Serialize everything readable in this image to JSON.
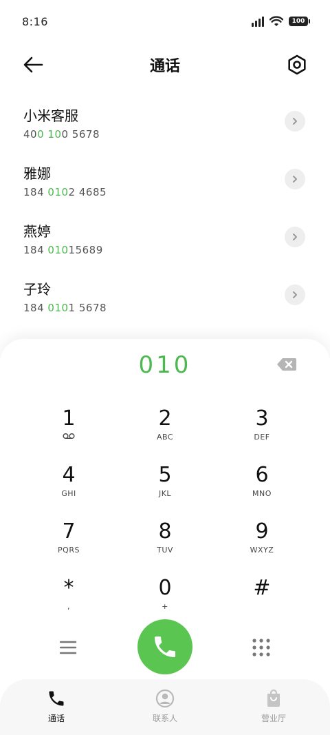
{
  "status": {
    "time": "8:16",
    "battery": "100"
  },
  "header": {
    "title": "通话"
  },
  "contacts": [
    {
      "name": "小米客服",
      "num_pre": "40",
      "num_hl": "0 10",
      "num_post": "0 5678"
    },
    {
      "name": "雅娜",
      "num_pre": "184 ",
      "num_hl": "010",
      "num_post": "2 4685"
    },
    {
      "name": "燕婷",
      "num_pre": "184 ",
      "num_hl": "010",
      "num_post": "15689"
    },
    {
      "name": "子玲",
      "num_pre": "184 ",
      "num_hl": "010",
      "num_post": "1 5678"
    }
  ],
  "dialer": {
    "input": "010",
    "keys": [
      {
        "digit": "1",
        "letters": ""
      },
      {
        "digit": "2",
        "letters": "ABC"
      },
      {
        "digit": "3",
        "letters": "DEF"
      },
      {
        "digit": "4",
        "letters": "GHI"
      },
      {
        "digit": "5",
        "letters": "JKL"
      },
      {
        "digit": "6",
        "letters": "MNO"
      },
      {
        "digit": "7",
        "letters": "PQRS"
      },
      {
        "digit": "8",
        "letters": "TUV"
      },
      {
        "digit": "9",
        "letters": "WXYZ"
      },
      {
        "digit": "*",
        "letters": ","
      },
      {
        "digit": "0",
        "letters": "+"
      },
      {
        "digit": "#",
        "letters": ""
      }
    ]
  },
  "tabs": [
    {
      "label": "通话",
      "icon": "phone-icon",
      "active": true
    },
    {
      "label": "联系人",
      "icon": "person-icon",
      "active": false
    },
    {
      "label": "营业厅",
      "icon": "bag-icon",
      "active": false
    }
  ],
  "colors": {
    "accent": "#4cb84f",
    "call_button": "#5bc552",
    "inactive": "#b8b8b8"
  }
}
